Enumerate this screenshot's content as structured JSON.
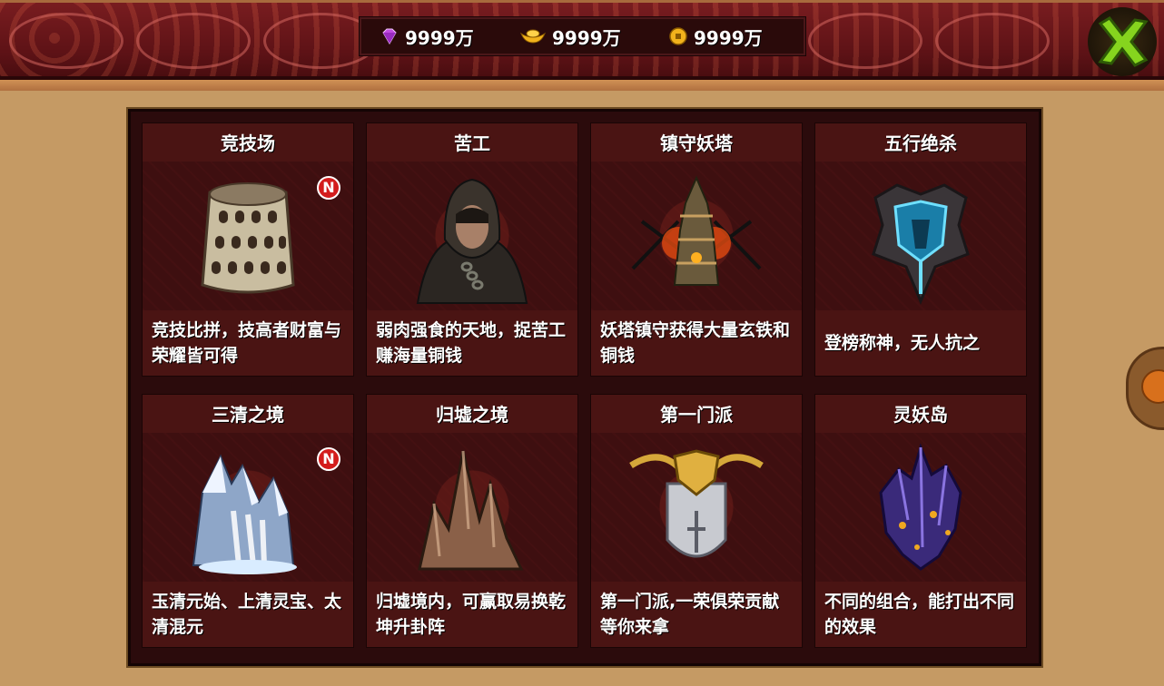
{
  "currency": {
    "diamond": "9999万",
    "gold_ingot": "9999万",
    "coin": "9999万"
  },
  "icons": {
    "diamond": "purple-diamond-icon",
    "gold_ingot": "gold-ingot-icon",
    "coin": "gold-coin-icon",
    "close": "green-x-icon"
  },
  "colors": {
    "banner": "#5d1216",
    "panel": "#2b0b0c",
    "card": "#3b0f10",
    "badge": "#d31c1c",
    "close": "#7ed321"
  },
  "badge_label": "N",
  "activities": [
    {
      "title": "竞技场",
      "desc": "竞技比拼，技高者财富与荣耀皆可得",
      "is_new": true,
      "art": "colosseum-icon"
    },
    {
      "title": "苦工",
      "desc": "弱肉强食的天地，捉苦工赚海量铜钱",
      "is_new": false,
      "art": "hooded-laborer-icon"
    },
    {
      "title": "镇守妖塔",
      "desc": "妖塔镇守获得大量玄铁和铜钱",
      "is_new": false,
      "art": "demon-tower-icon"
    },
    {
      "title": "五行绝杀",
      "desc": "登榜称神，无人抗之",
      "is_new": false,
      "art": "crest-icon"
    },
    {
      "title": "三清之境",
      "desc": "玉清元始、上清灵宝、太清混元",
      "is_new": true,
      "art": "icy-mountain-icon"
    },
    {
      "title": "归墟之境",
      "desc": "归墟境内，可赢取易换乾坤升卦阵",
      "is_new": false,
      "art": "rock-spire-icon"
    },
    {
      "title": "第一门派",
      "desc": "第一门派,一荣俱荣贡献等你来拿",
      "is_new": false,
      "art": "sect-shield-icon"
    },
    {
      "title": "灵妖岛",
      "desc": "不同的组合，能打出不同的效果",
      "is_new": false,
      "art": "spirit-island-icon"
    }
  ]
}
